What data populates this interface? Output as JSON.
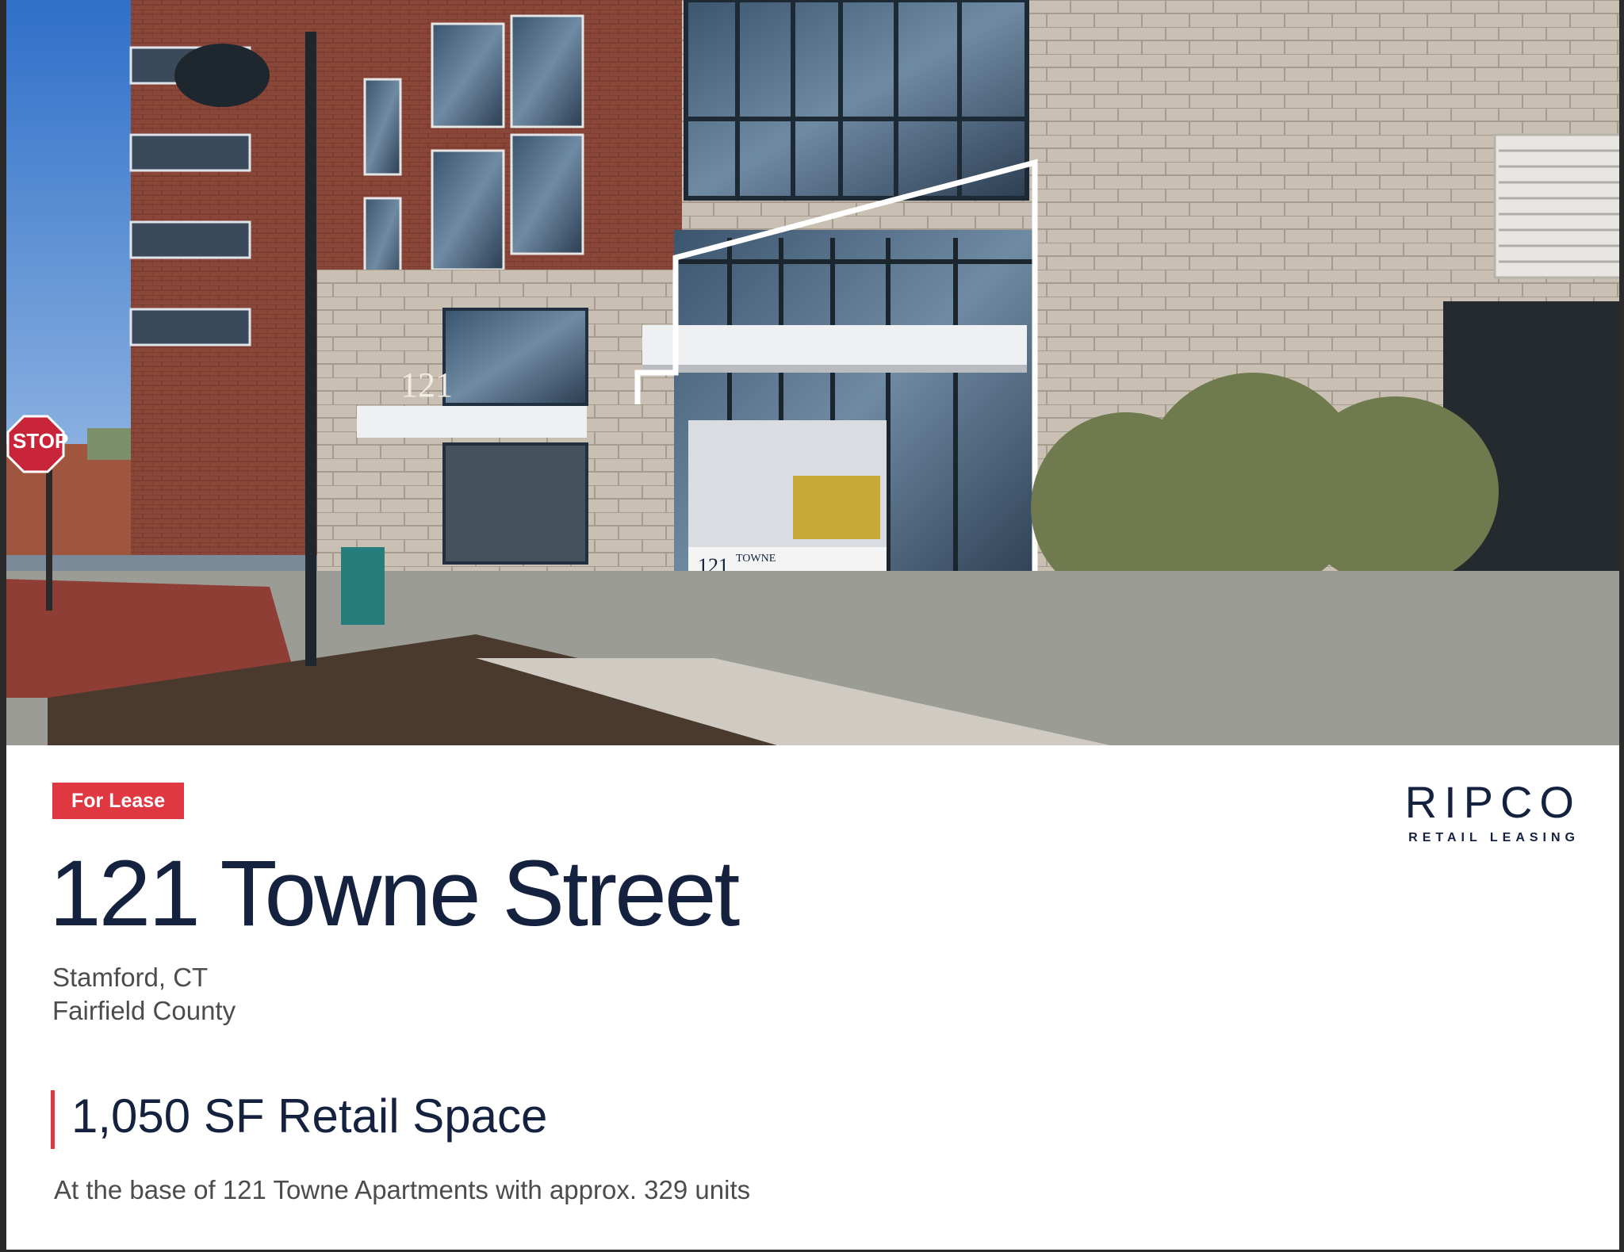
{
  "photo": {
    "stop_sign_text": "STOP",
    "building_number": "121",
    "window_sign_number": "121",
    "window_sign_name": "TOWNE"
  },
  "badge": {
    "label": "For Lease"
  },
  "title": "121 Towne Street",
  "location": {
    "city": "Stamford, CT",
    "county": "Fairfield County"
  },
  "space": {
    "headline": "1,050 SF Retail Space",
    "description": "At the base of 121 Towne Apartments with approx. 329 units"
  },
  "brand": {
    "name": "RIPCO",
    "tagline": "RETAIL LEASING"
  },
  "colors": {
    "accent_red": "#e03841",
    "navy": "#14213f",
    "gray_text": "#4c4c4c"
  }
}
